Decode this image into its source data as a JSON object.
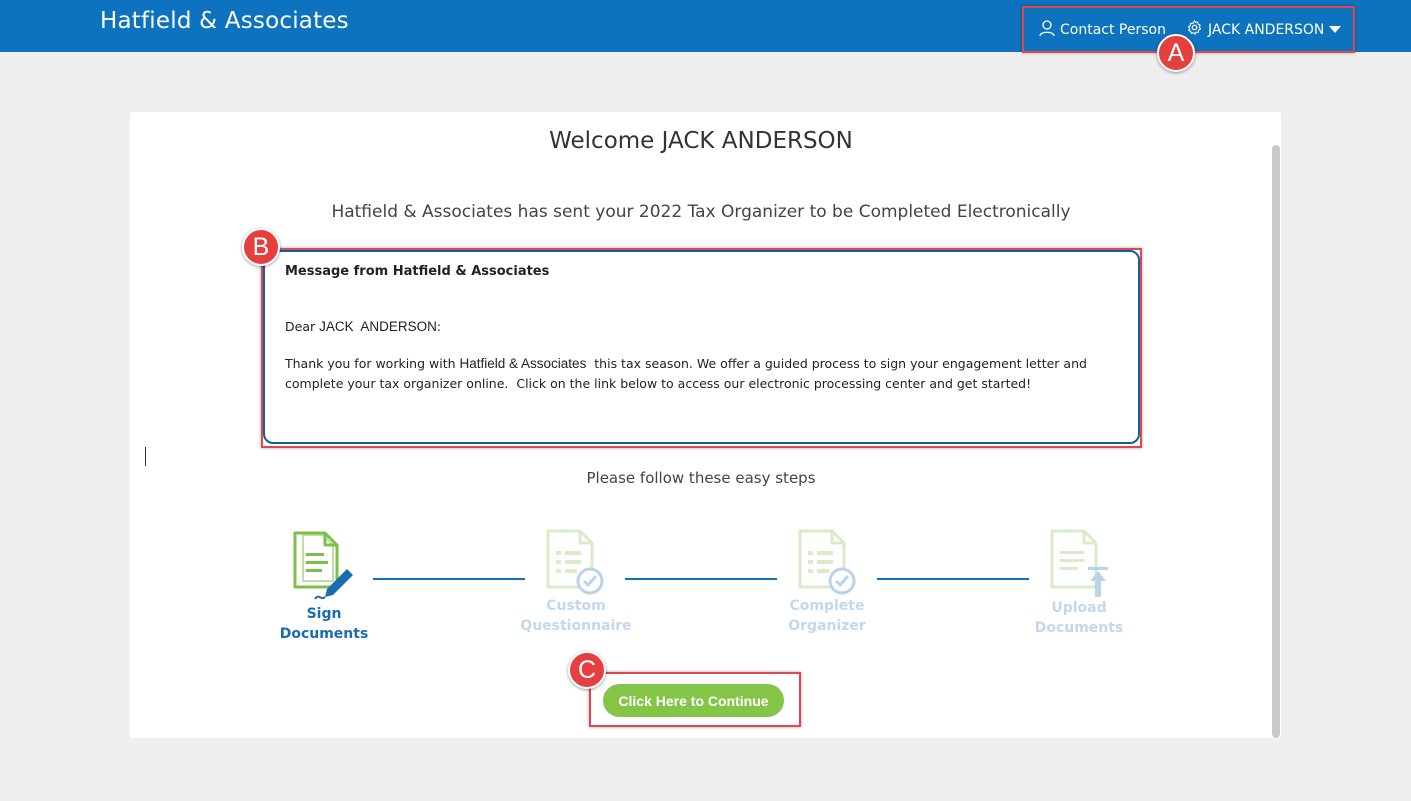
{
  "header": {
    "brand": "Hatfield & Associates",
    "contact_label": "Contact Person",
    "user_name": "JACK ANDERSON"
  },
  "main": {
    "welcome": "Welcome JACK ANDERSON",
    "sent_line": "Hatfield & Associates has sent your 2022 Tax Organizer to be Completed Electronically",
    "message": {
      "title": "Message from Hatfield & Associates",
      "dear_prefix": "Dear ",
      "dear_name": "JACK  ANDERSON",
      "dear_suffix": ":",
      "body_part1": "Thank you for working with ",
      "body_firm": "Hatfield & Associates",
      "body_part2": "  this tax season. We offer a guided process to sign your engagement letter and complete your tax organizer online.  Click on the link below to access our electronic processing center and get started!"
    },
    "follow_text": "Please follow these easy steps",
    "steps": [
      {
        "line1": "Sign",
        "line2": "Documents",
        "state": "active"
      },
      {
        "line1": "Custom",
        "line2": "Questionnaire",
        "state": "inactive"
      },
      {
        "line1": "Complete",
        "line2": "Organizer",
        "state": "inactive"
      },
      {
        "line1": "Upload",
        "line2": "Documents",
        "state": "inactive"
      }
    ],
    "continue_label": "Click Here to Continue"
  },
  "annotations": {
    "a": "A",
    "b": "B",
    "c": "C"
  },
  "colors": {
    "header": "#0d73be",
    "accent_green": "#84c547",
    "annotation_red": "#e5403f",
    "active_step": "#1a6bb0"
  }
}
